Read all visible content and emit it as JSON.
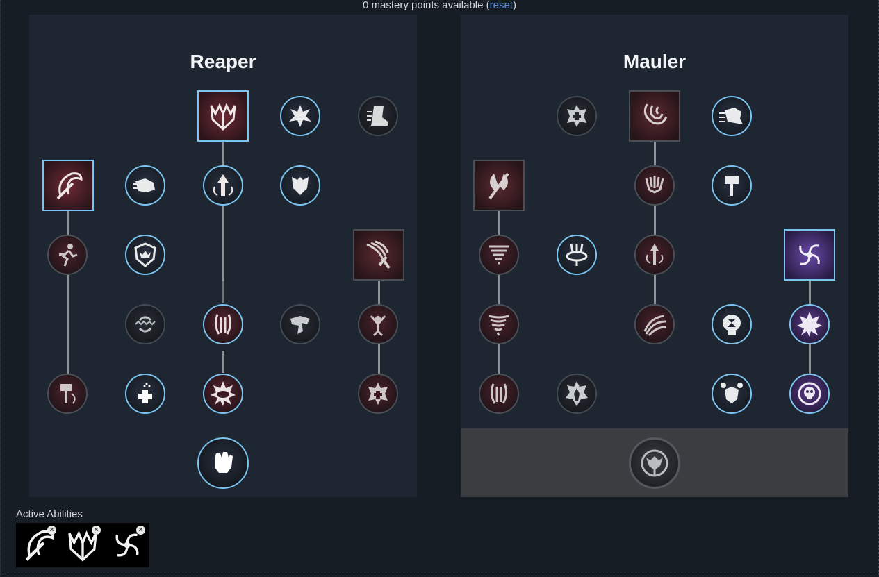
{
  "header": {
    "prefix": "0 mastery points available (",
    "reset_label": "reset",
    "suffix": ")"
  },
  "trees": [
    {
      "title": "Reaper"
    },
    {
      "title": "Mauler"
    }
  ],
  "active": {
    "label": "Active Abilities",
    "slots": [
      {
        "icon": "axe-swing-icon",
        "remove": "×"
      },
      {
        "icon": "reaper-crown-icon",
        "remove": "×"
      },
      {
        "icon": "vortex-icon",
        "remove": "×"
      }
    ]
  },
  "colors": {
    "background": "#171d24",
    "panel": "#1e2631",
    "selected_border": "#7cc4f0",
    "reset_link": "#5b8fd8"
  }
}
